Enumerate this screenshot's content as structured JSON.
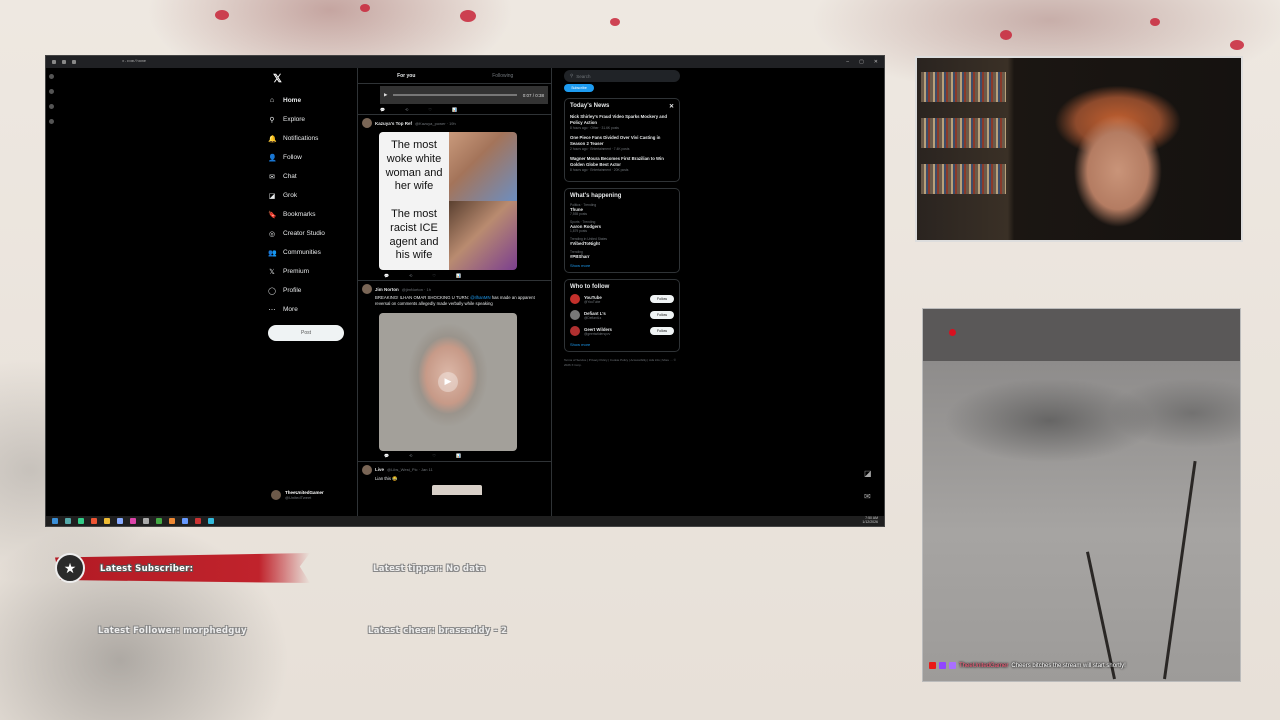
{
  "browser": {
    "url": "x.com/home",
    "window_controls": [
      "–",
      "▢",
      "✕"
    ]
  },
  "x": {
    "nav": [
      {
        "label": "Home",
        "icon": "⌂"
      },
      {
        "label": "Explore",
        "icon": "⚲"
      },
      {
        "label": "Notifications",
        "icon": "🔔"
      },
      {
        "label": "Follow",
        "icon": "👤"
      },
      {
        "label": "Chat",
        "icon": "✉"
      },
      {
        "label": "Grok",
        "icon": "◪"
      },
      {
        "label": "Bookmarks",
        "icon": "🔖"
      },
      {
        "label": "Creator Studio",
        "icon": "◎"
      },
      {
        "label": "Communities",
        "icon": "👥"
      },
      {
        "label": "Premium",
        "icon": "𝕏"
      },
      {
        "label": "Profile",
        "icon": "◯"
      },
      {
        "label": "More",
        "icon": "⋯"
      }
    ],
    "post_label": "Post",
    "logo": "𝕏",
    "user": {
      "name": "TheeUnitedGamer",
      "handle": "@UnitedTweet"
    }
  },
  "feed": {
    "tabs": [
      "For you",
      "Following"
    ],
    "video_time": "0:07 / 0:38",
    "tweets": [
      {
        "name": "Kazuya's Top Ref",
        "handle": "@Kazuya_power · 19h",
        "meme": {
          "top": "The most woke white woman and her wife",
          "bottom": "The most racist ICE agent and his wife"
        }
      },
      {
        "name": "Jim Norton",
        "handle": "@jimNorton · 1h",
        "text_a": "BREAKING! ILHAN OMAR SHOCKING U TURN: ",
        "mention": "@IlhanMN",
        "text_b": " has made an apparent reversal on comments allegedly made verbally while speaking"
      },
      {
        "name": "Live",
        "handle": "@Libs_West_Pic · Jan 11",
        "text": "Lian this 😂"
      }
    ]
  },
  "right": {
    "search_placeholder": "Search",
    "subscribe_label": "Subscribe",
    "todays_news_title": "Today's News",
    "close": "✕",
    "news": [
      {
        "headline": "Nick Shirley's Fraud Video Sparks Mockery and Policy Action",
        "meta": "8 hours ago · Other · 31.6K posts"
      },
      {
        "headline": "One Piece Fans Divided Over Vivi Casting in Season 2 Teaser",
        "meta": "2 hours ago · Entertainment · 7.4K posts"
      },
      {
        "headline": "Wagner Moura Becomes First Brazilian to Win Golden Globe Best Actor",
        "meta": "8 hours ago · Entertainment · 20K posts"
      }
    ],
    "happening_title": "What's happening",
    "trends": [
      {
        "context": "Politics · Trending",
        "title": "Thune",
        "posts": "7,555 posts"
      },
      {
        "context": "Sports · Trending",
        "title": "Aaron Rodgers",
        "posts": "1,879 posts"
      },
      {
        "context": "Trending in United States",
        "title": "#VibedToNight",
        "posts": ""
      },
      {
        "context": "Trending",
        "title": "#PBSharr",
        "posts": ""
      }
    ],
    "show_more": "Show more",
    "who_to_follow_title": "Who to follow",
    "follow": [
      {
        "name": "YouTube",
        "handle": "@YouTube",
        "button": "Follow"
      },
      {
        "name": "Defiant L's",
        "handle": "@DefiantLs",
        "button": "Follow"
      },
      {
        "name": "Geert Wilders",
        "handle": "@geertwilderspvv",
        "button": "Follow"
      }
    ],
    "footer": "Terms of Service | Privacy Policy | Cookie Policy | Accessibility | Ads info | More ··· © 2026 X Corp."
  },
  "taskbar": {
    "time": "7:50 AM",
    "date": "1/12/2026"
  },
  "overlay": {
    "latest_subscriber": "Latest Subscriber:",
    "latest_tipper": "Latest tipper: No data",
    "latest_follower": "Latest Follower: morphedguy",
    "latest_cheer": "Latest cheer: brassaddy - 2"
  },
  "chat": {
    "user": "TheeUnitedGamer",
    "message": "Cheers bitches the stream will start shortly!"
  },
  "colors": {
    "accent_red": "#c0232c",
    "x_blue": "#1d9bf0",
    "x_bg": "#000000"
  }
}
